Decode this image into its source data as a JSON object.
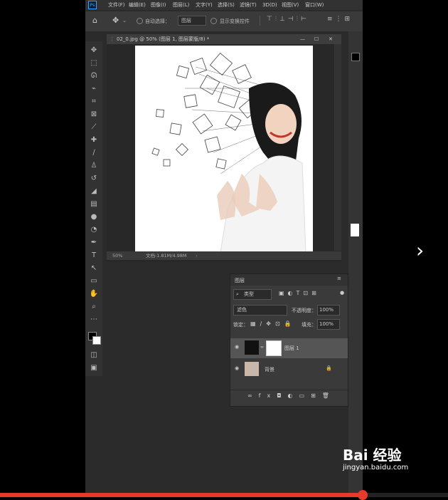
{
  "app": {
    "logo_text": "Ps"
  },
  "menubar": [
    "文件(F)",
    "编辑(E)",
    "图像(I)",
    "图层(L)",
    "文字(Y)",
    "选择(S)",
    "滤镜(T)",
    "3D(D)",
    "视图(V)",
    "窗口(W)"
  ],
  "options": {
    "auto_select_label": "自动选择：",
    "auto_select_value": "图层",
    "show_transform_label": "显示变换控件"
  },
  "document": {
    "tab_title": "02_0.jpg @ 50% (图层 1, 图层蒙版/8) *",
    "zoom": "50%",
    "doc_size": "文档:1.81M/4.98M"
  },
  "layers_panel": {
    "title": "图层",
    "filter_label": "类型",
    "blend_mode": "滤色",
    "opacity_label": "不透明度：",
    "opacity_value": "100%",
    "lock_label": "锁定：",
    "fill_label": "填充：",
    "fill_value": "100%",
    "layers": [
      {
        "name": "图层 1",
        "selected": true
      },
      {
        "name": "背景",
        "selected": false
      }
    ]
  },
  "watermark": {
    "brand": "Bai 经验",
    "url": "jingyan.baidu.com"
  },
  "video": {
    "progress": 0.81
  },
  "colors": {
    "accent": "#31a8ff",
    "progress": "#e63a2a",
    "panel": "#3a3a3a",
    "canvas": "#ffffff"
  }
}
